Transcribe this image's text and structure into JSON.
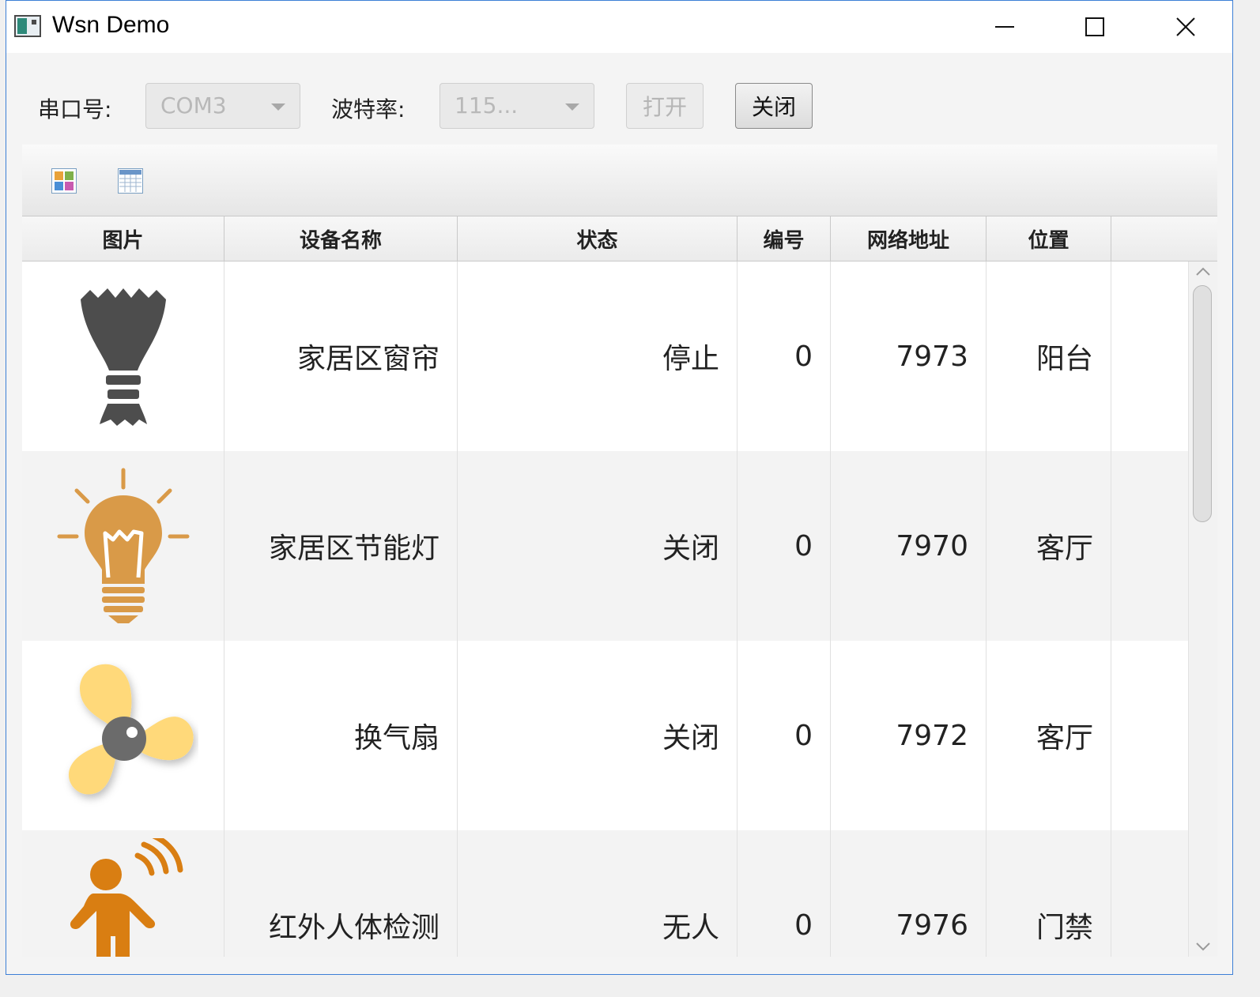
{
  "window": {
    "title": "Wsn Demo",
    "controls": [
      "minimize-icon",
      "maximize-icon",
      "close-icon"
    ]
  },
  "toolbar": {
    "port_label": "串口号:",
    "port_value": "COM3",
    "baud_label": "波特率:",
    "baud_value": "115...",
    "open_label": "打开",
    "close_label": "关闭"
  },
  "view_icons": [
    "tile-view-icon",
    "table-view-icon"
  ],
  "table": {
    "columns": [
      "图片",
      "设备名称",
      "状态",
      "编号",
      "网络地址",
      "位置"
    ],
    "rows": [
      {
        "icon": "curtain-icon",
        "name": "家居区窗帘",
        "status": "停止",
        "id": "0",
        "address": "7973",
        "location": "阳台"
      },
      {
        "icon": "light-bulb-icon",
        "name": "家居区节能灯",
        "status": "关闭",
        "id": "0",
        "address": "7970",
        "location": "客厅"
      },
      {
        "icon": "fan-icon",
        "name": "换气扇",
        "status": "关闭",
        "id": "0",
        "address": "7972",
        "location": "客厅"
      },
      {
        "icon": "motion-sensor-icon",
        "name": "红外人体检测",
        "status": "无人",
        "id": "0",
        "address": "7976",
        "location": "门禁"
      }
    ]
  },
  "colors": {
    "curtain": "#4d4d4d",
    "bulb": "#d99a48",
    "fan": "#ffd97a",
    "fan_hub": "#6b6b6b",
    "person": "#d97e12"
  }
}
